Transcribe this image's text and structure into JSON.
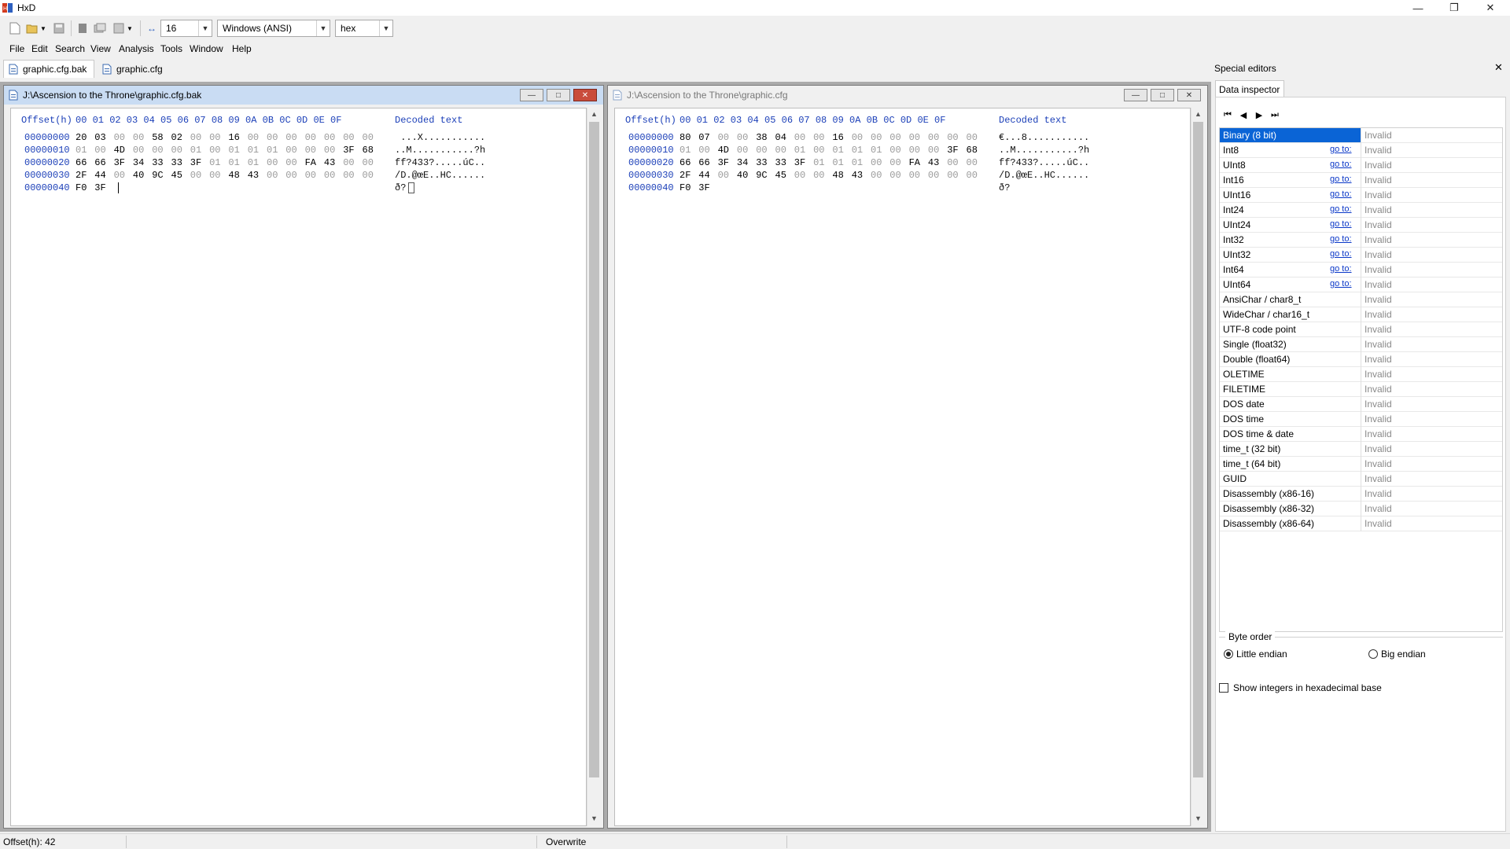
{
  "app": {
    "title": "HxD"
  },
  "toolbar": {
    "bytes_per_row": "16",
    "charset": "Windows (ANSI)",
    "display_mode": "hex"
  },
  "menu": [
    "File",
    "Edit",
    "Search",
    "View",
    "Analysis",
    "Tools",
    "Window",
    "Help"
  ],
  "tabs": [
    {
      "label": "graphic.cfg.bak",
      "active": true
    },
    {
      "label": "graphic.cfg",
      "active": false
    }
  ],
  "windows": [
    {
      "title": "J:\\Ascension to the Throne\\graphic.cfg.bak",
      "header": {
        "offset": "Offset(h)",
        "cols": "00 01 02 03 04 05 06 07 08 09 0A 0B 0C 0D 0E 0F",
        "decoded": "Decoded text"
      },
      "rows": [
        {
          "offset": "00000000",
          "bytes": [
            "20",
            "03",
            "00",
            "00",
            "58",
            "02",
            "00",
            "00",
            "16",
            "00",
            "00",
            "00",
            "00",
            "00",
            "00",
            "00"
          ],
          "text": " ...X..........."
        },
        {
          "offset": "00000010",
          "bytes": [
            "01",
            "00",
            "4D",
            "00",
            "00",
            "00",
            "01",
            "00",
            "01",
            "01",
            "01",
            "00",
            "00",
            "00",
            "3F",
            "68"
          ],
          "text": "..M...........?h"
        },
        {
          "offset": "00000020",
          "bytes": [
            "66",
            "66",
            "3F",
            "34",
            "33",
            "33",
            "3F",
            "01",
            "01",
            "01",
            "00",
            "00",
            "FA",
            "43",
            "00",
            "00"
          ],
          "text": "ff?433?.....úC.."
        },
        {
          "offset": "00000030",
          "bytes": [
            "2F",
            "44",
            "00",
            "40",
            "9C",
            "45",
            "00",
            "00",
            "48",
            "43",
            "00",
            "00",
            "00",
            "00",
            "00",
            "00"
          ],
          "text": "/D.@œE..HC......"
        },
        {
          "offset": "00000040",
          "bytes": [
            "F0",
            "3F"
          ],
          "text": "ð?"
        }
      ]
    },
    {
      "title": "J:\\Ascension to the Throne\\graphic.cfg",
      "header": {
        "offset": "Offset(h)",
        "cols": "00 01 02 03 04 05 06 07 08 09 0A 0B 0C 0D 0E 0F",
        "decoded": "Decoded text"
      },
      "rows": [
        {
          "offset": "00000000",
          "bytes": [
            "80",
            "07",
            "00",
            "00",
            "38",
            "04",
            "00",
            "00",
            "16",
            "00",
            "00",
            "00",
            "00",
            "00",
            "00",
            "00"
          ],
          "text": "€...8..........."
        },
        {
          "offset": "00000010",
          "bytes": [
            "01",
            "00",
            "4D",
            "00",
            "00",
            "00",
            "01",
            "00",
            "01",
            "01",
            "01",
            "00",
            "00",
            "00",
            "3F",
            "68"
          ],
          "text": "..M...........?h"
        },
        {
          "offset": "00000020",
          "bytes": [
            "66",
            "66",
            "3F",
            "34",
            "33",
            "33",
            "3F",
            "01",
            "01",
            "01",
            "00",
            "00",
            "FA",
            "43",
            "00",
            "00"
          ],
          "text": "ff?433?.....úC.."
        },
        {
          "offset": "00000030",
          "bytes": [
            "2F",
            "44",
            "00",
            "40",
            "9C",
            "45",
            "00",
            "00",
            "48",
            "43",
            "00",
            "00",
            "00",
            "00",
            "00",
            "00"
          ],
          "text": "/D.@œE..HC......"
        },
        {
          "offset": "00000040",
          "bytes": [
            "F0",
            "3F"
          ],
          "text": "ð?"
        }
      ]
    }
  ],
  "special_editors": {
    "title": "Special editors",
    "tab": "Data inspector",
    "goto_label": "go to:",
    "rows": [
      {
        "name": "Binary (8 bit)",
        "value": "Invalid",
        "goto": false
      },
      {
        "name": "Int8",
        "value": "Invalid",
        "goto": true
      },
      {
        "name": "UInt8",
        "value": "Invalid",
        "goto": true
      },
      {
        "name": "Int16",
        "value": "Invalid",
        "goto": true
      },
      {
        "name": "UInt16",
        "value": "Invalid",
        "goto": true
      },
      {
        "name": "Int24",
        "value": "Invalid",
        "goto": true
      },
      {
        "name": "UInt24",
        "value": "Invalid",
        "goto": true
      },
      {
        "name": "Int32",
        "value": "Invalid",
        "goto": true
      },
      {
        "name": "UInt32",
        "value": "Invalid",
        "goto": true
      },
      {
        "name": "Int64",
        "value": "Invalid",
        "goto": true
      },
      {
        "name": "UInt64",
        "value": "Invalid",
        "goto": true
      },
      {
        "name": "AnsiChar / char8_t",
        "value": "Invalid",
        "goto": false
      },
      {
        "name": "WideChar / char16_t",
        "value": "Invalid",
        "goto": false
      },
      {
        "name": "UTF-8 code point",
        "value": "Invalid",
        "goto": false
      },
      {
        "name": "Single (float32)",
        "value": "Invalid",
        "goto": false
      },
      {
        "name": "Double (float64)",
        "value": "Invalid",
        "goto": false
      },
      {
        "name": "OLETIME",
        "value": "Invalid",
        "goto": false
      },
      {
        "name": "FILETIME",
        "value": "Invalid",
        "goto": false
      },
      {
        "name": "DOS date",
        "value": "Invalid",
        "goto": false
      },
      {
        "name": "DOS time",
        "value": "Invalid",
        "goto": false
      },
      {
        "name": "DOS time & date",
        "value": "Invalid",
        "goto": false
      },
      {
        "name": "time_t (32 bit)",
        "value": "Invalid",
        "goto": false
      },
      {
        "name": "time_t (64 bit)",
        "value": "Invalid",
        "goto": false
      },
      {
        "name": "GUID",
        "value": "Invalid",
        "goto": false
      },
      {
        "name": "Disassembly (x86-16)",
        "value": "Invalid",
        "goto": false
      },
      {
        "name": "Disassembly (x86-32)",
        "value": "Invalid",
        "goto": false
      },
      {
        "name": "Disassembly (x86-64)",
        "value": "Invalid",
        "goto": false
      }
    ],
    "byte_order": {
      "title": "Byte order",
      "little": "Little endian",
      "big": "Big endian",
      "selected": "little"
    },
    "hex_base_label": "Show integers in hexadecimal base"
  },
  "statusbar": {
    "offset": "Offset(h): 42",
    "mode": "Overwrite"
  }
}
